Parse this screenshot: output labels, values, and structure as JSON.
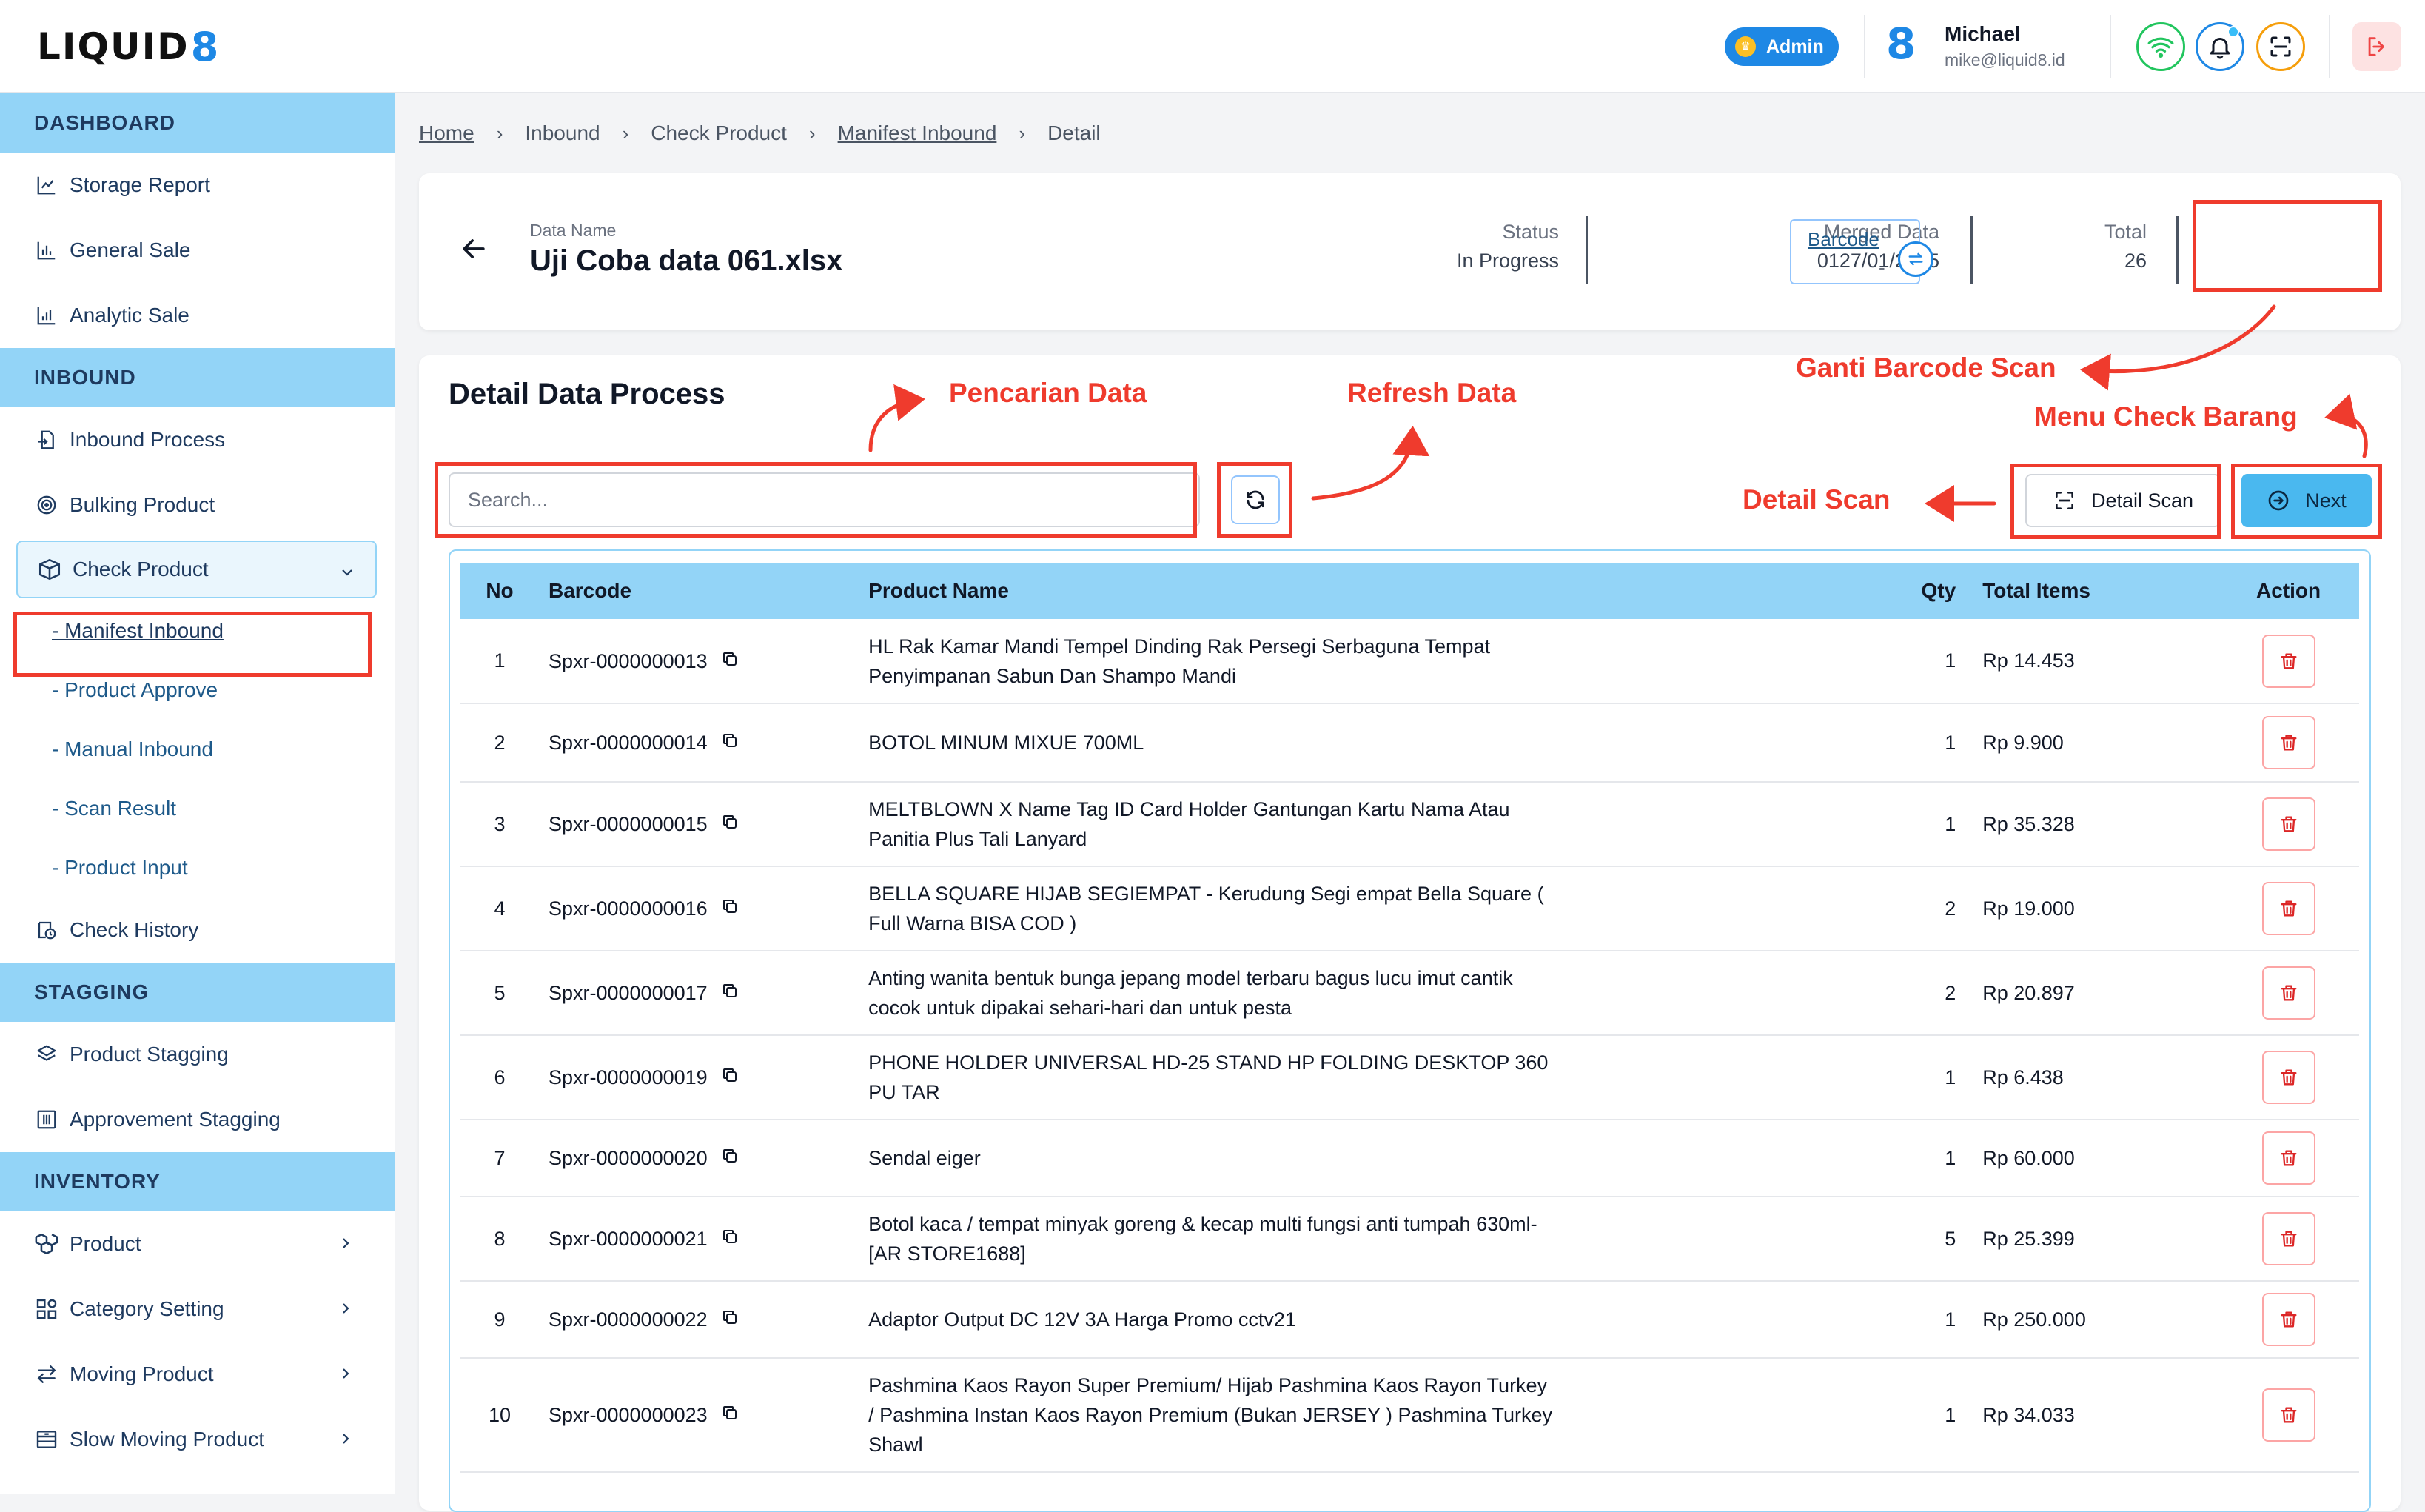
{
  "brand": {
    "logo_text": "LIQUID",
    "logo_mark": "8"
  },
  "header": {
    "role_badge": "Admin",
    "user_mark": "8",
    "user_name": "Michael",
    "user_email": "mike@liquid8.id",
    "icons": [
      "wifi-icon",
      "bell-icon",
      "scan-icon",
      "logout-icon"
    ]
  },
  "sidebar": {
    "sections": {
      "dashboard": "DASHBOARD",
      "inbound": "INBOUND",
      "stagging": "STAGGING",
      "inventory": "INVENTORY"
    },
    "dashboard_items": [
      "Storage Report",
      "General Sale",
      "Analytic Sale"
    ],
    "inbound_items": [
      "Inbound Process",
      "Bulking Product"
    ],
    "check_product": "Check Product",
    "check_product_sub": [
      "- Manifest Inbound",
      "- Product Approve",
      "- Manual Inbound",
      "- Scan Result",
      "- Product Input"
    ],
    "check_history": "Check History",
    "stagging_items": [
      "Product Stagging",
      "Approvement Stagging"
    ],
    "inventory_items": [
      "Product",
      "Category Setting",
      "Moving Product",
      "Slow Moving Product"
    ]
  },
  "breadcrumb": [
    "Home",
    "Inbound",
    "Check Product",
    "Manifest Inbound",
    "Detail"
  ],
  "info": {
    "data_name_label": "Data Name",
    "data_name": "Uji Coba data 061.xlsx",
    "status_label": "Status",
    "status": "In Progress",
    "merged_label": "Merged Data",
    "merged": "0127/01/2025",
    "total_label": "Total",
    "total": "26",
    "barcode_label": "Barcode",
    "barcode_value": "-"
  },
  "main": {
    "title": "Detail Data Process",
    "search_placeholder": "Search...",
    "detail_scan_label": "Detail Scan",
    "next_label": "Next"
  },
  "table": {
    "headers": [
      "No",
      "Barcode",
      "Product Name",
      "Qty",
      "Total Items",
      "Action"
    ],
    "rows": [
      {
        "no": "1",
        "barcode": "Spxr-0000000013",
        "name": "HL Rak Kamar Mandi Tempel Dinding Rak Persegi Serbaguna Tempat Penyimpanan Sabun Dan Shampo Mandi",
        "qty": "1",
        "total": "Rp 14.453"
      },
      {
        "no": "2",
        "barcode": "Spxr-0000000014",
        "name": "BOTOL MINUM MIXUE 700ML",
        "qty": "1",
        "total": "Rp 9.900"
      },
      {
        "no": "3",
        "barcode": "Spxr-0000000015",
        "name": "MELTBLOWN X Name Tag ID Card Holder Gantungan Kartu Nama Atau Panitia Plus Tali Lanyard",
        "qty": "1",
        "total": "Rp 35.328"
      },
      {
        "no": "4",
        "barcode": "Spxr-0000000016",
        "name": "BELLA SQUARE HIJAB SEGIEMPAT - Kerudung Segi empat Bella Square ( Full Warna BISA COD )",
        "qty": "2",
        "total": "Rp 19.000"
      },
      {
        "no": "5",
        "barcode": "Spxr-0000000017",
        "name": "Anting wanita bentuk bunga jepang model terbaru bagus lucu imut cantik cocok untuk dipakai sehari-hari dan untuk pesta",
        "qty": "2",
        "total": "Rp 20.897"
      },
      {
        "no": "6",
        "barcode": "Spxr-0000000019",
        "name": "PHONE HOLDER UNIVERSAL HD-25 STAND HP FOLDING DESKTOP 360 PU TAR",
        "qty": "1",
        "total": "Rp 6.438"
      },
      {
        "no": "7",
        "barcode": "Spxr-0000000020",
        "name": "Sendal eiger",
        "qty": "1",
        "total": "Rp 60.000"
      },
      {
        "no": "8",
        "barcode": "Spxr-0000000021",
        "name": "Botol kaca / tempat minyak goreng & kecap multi fungsi anti tumpah 630ml-[AR STORE1688]",
        "qty": "5",
        "total": "Rp 25.399"
      },
      {
        "no": "9",
        "barcode": "Spxr-0000000022",
        "name": "Adaptor Output DC 12V 3A Harga Promo cctv21",
        "qty": "1",
        "total": "Rp 250.000"
      },
      {
        "no": "10",
        "barcode": "Spxr-0000000023",
        "name": "Pashmina Kaos Rayon Super Premium/ Hijab Pashmina Kaos Rayon Turkey / Pashmina Instan Kaos Rayon Premium (Bukan JERSEY ) Pashmina Turkey Shawl",
        "qty": "1",
        "total": "Rp 34.033"
      }
    ]
  },
  "annotations": {
    "search": "Pencarian Data",
    "refresh": "Refresh Data",
    "barcode": "Ganti Barcode Scan",
    "check": "Menu Check Barang",
    "detail_scan": "Detail Scan",
    "color": "#ef3b2d"
  },
  "colors": {
    "accent": "#1e88e5",
    "section_bg": "#93d4f7",
    "next_bg": "#4ab8ef",
    "danger": "#dc2626"
  }
}
